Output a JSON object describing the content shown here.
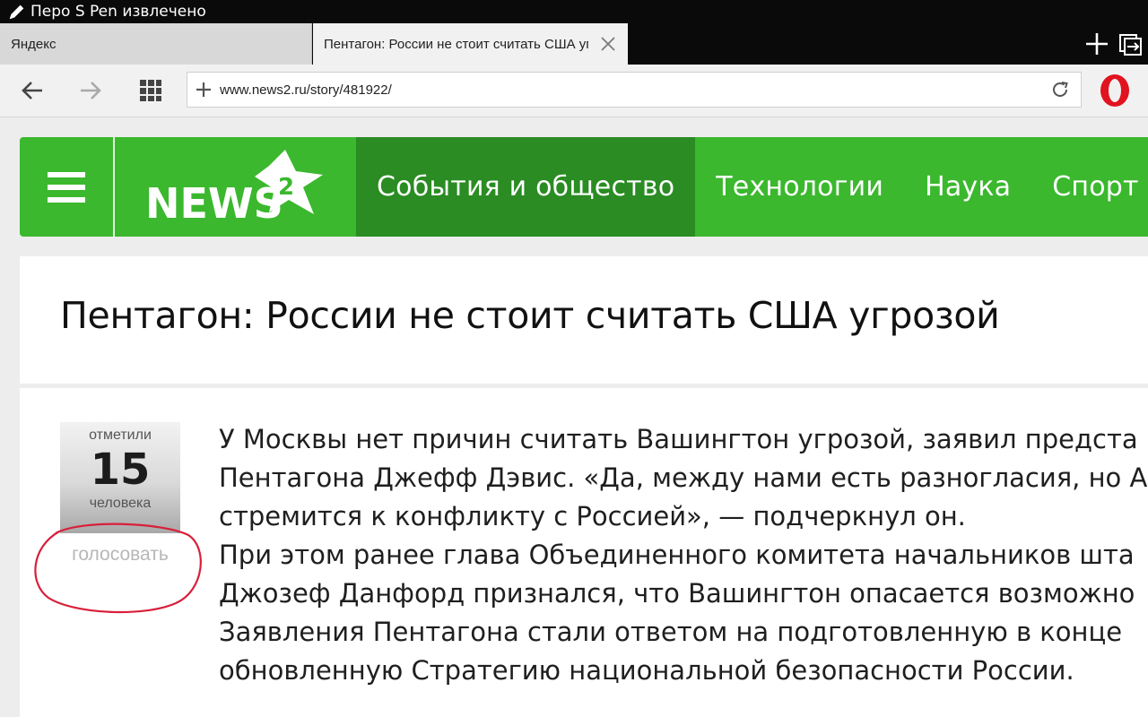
{
  "statusbar": {
    "message": "Перо S Pen извлечено"
  },
  "tabs": [
    {
      "label": "Яндекс"
    },
    {
      "label": "Пентагон: России не стоит считать США угрозой"
    }
  ],
  "address": {
    "url": "www.news2.ru/story/481922/"
  },
  "site": {
    "logo_text": "NEWS",
    "logo_badge": "2",
    "nav": [
      "События и общество",
      "Технологии",
      "Наука",
      "Спорт",
      "А"
    ]
  },
  "article": {
    "title": "Пентагон: России не стоит считать США угрозой",
    "paragraph_lines": [
      "У Москвы нет причин считать Вашингтон угрозой, заявил предста",
      "Пентагона Джефф Дэвис. «Да, между нами есть разногласия, но А",
      "стремится к конфликту с Россией», — подчеркнул он.",
      "При этом ранее глава Объединенного комитета начальников шта",
      "Джозеф Данфорд признался, что Вашингтон опасается возможно",
      "Заявления Пентагона стали ответом на подготовленную в конце",
      "обновленную Стратегию национальной безопасности России."
    ]
  },
  "vote": {
    "top_label": "отметили",
    "count": "15",
    "bottom_label": "человека",
    "link_label": "голосовать"
  },
  "colors": {
    "site_green": "#3bb82e",
    "active_nav_green": "#2a8c23",
    "opera_red": "#e0131f",
    "annotation_red": "#d81f3a"
  },
  "icons": [
    "pen-icon",
    "tab-close-icon",
    "new-tab-icon",
    "tab-manager-icon",
    "back-icon",
    "forward-icon",
    "speed-dial-icon",
    "add-icon",
    "reload-icon",
    "opera-menu-icon",
    "hamburger-icon"
  ]
}
